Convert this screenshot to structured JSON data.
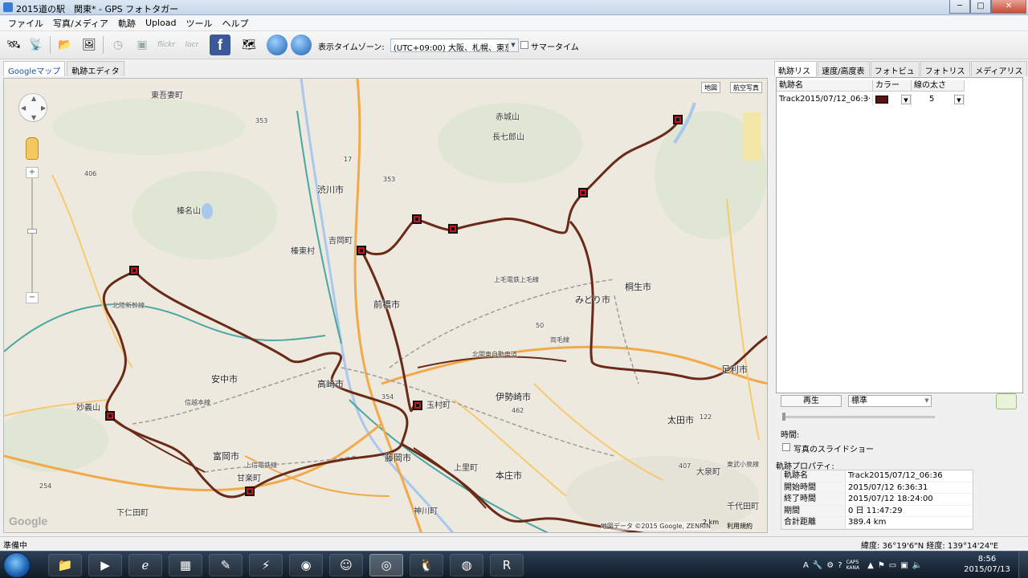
{
  "window": {
    "title": "2015道の駅　関東* - GPS フォトタガー",
    "minimize": "─",
    "maximize": "□",
    "close": "✕"
  },
  "menu": [
    "ファイル",
    "写真/メディア",
    "軌跡",
    "Upload",
    "ツール",
    "ヘルプ"
  ],
  "toolbar": {
    "timezone_label": "表示タイムゾーン:",
    "timezone_value": "(UTC+09:00) 大阪、札幌、東京",
    "summer_label": "サマータイム",
    "icons": [
      "gps-device-icon",
      "gps-receive-icon",
      "open-folder-icon",
      "photo-icon",
      "clock-icon",
      "camera-icon",
      "flickr-icon",
      "locr-icon",
      "facebook-icon",
      "picasa-icon",
      "google-earth-icon",
      "google-earth-kmz-icon"
    ],
    "flickr": "flickr",
    "locr": "locr",
    "facebook": "f"
  },
  "left_tabs": [
    "Googleマップ",
    "軌跡エディタ"
  ],
  "map": {
    "type_buttons": [
      "地図",
      "航空写真"
    ],
    "labels": {
      "higashiagatsuma": "東吾妻町",
      "shibukawa": "渋川市",
      "akagi": "赤城山",
      "choshichiro": "長七郎山",
      "haruna": "榛名山",
      "yoshioka": "吉岡町",
      "shinto": "榛東村",
      "maebashi": "前橋市",
      "midori": "みどり市",
      "kiryu": "桐生市",
      "jomo": "上毛電鉄上毛線",
      "hokuriku": "北陸新幹線",
      "annaka": "安中市",
      "takasaki": "高崎市",
      "tamamura": "玉村町",
      "isesaki": "伊勢崎市",
      "ashikaga": "足利市",
      "ota": "太田市",
      "myogi": "妙義山",
      "shinetsu": "信越本線",
      "tomioka": "富岡市",
      "joshin": "上信電鉄線",
      "kanra": "甘楽町",
      "fujioka": "藤岡市",
      "kamisato": "上里町",
      "honjo": "本庄市",
      "kamikawa": "神川町",
      "shimonita": "下仁田町",
      "oizumi": "大泉町",
      "chiyoda": "千代田町",
      "higashikoizumi": "東武小泉線",
      "ryomo": "両毛線",
      "kitakanto": "北関東自動車道",
      "route_353a": "353",
      "route_17": "17",
      "route_353b": "353",
      "route_406": "406",
      "route_354": "354",
      "route_462": "462",
      "route_50": "50",
      "route_122": "122",
      "route_254": "254",
      "route_407": "407"
    },
    "attribution": "地図データ ©2015 Google, ZENRIN",
    "scale": "2 km",
    "terms": "利用規約",
    "google": "Google"
  },
  "right_tabs": [
    "軌跡リスト",
    "速度/高度表示",
    "フォトビュー",
    "フォトリスト",
    "メディアリスト"
  ],
  "track_table": {
    "headers": [
      "軌跡名",
      "カラー",
      "線の太さ"
    ],
    "rows": [
      {
        "name": "Track2015/07/12_06:3",
        "more": "···",
        "width": "5",
        "color": "#5a1212"
      }
    ]
  },
  "playback": {
    "play": "再生",
    "speed": "標準",
    "time_label": "時間:",
    "slideshow_label": "写真のスライドショー"
  },
  "properties": {
    "title": "軌跡プロパティ:",
    "rows": [
      {
        "key": "軌跡名",
        "value": "Track2015/07/12_06:36"
      },
      {
        "key": "開始時間",
        "value": "2015/07/12 6:36:31"
      },
      {
        "key": "終了時間",
        "value": "2015/07/12 18:24:00"
      },
      {
        "key": "期間",
        "value": "0 日  11:47:29"
      },
      {
        "key": "合計距離",
        "value": "389.4 km"
      }
    ]
  },
  "status": {
    "left": "準備中",
    "right": "緯度: 36°19'6\"N  経度: 139°14'24\"E"
  },
  "taskbar": {
    "clock_time": "8:56",
    "clock_date": "2015/07/13",
    "caps": "CAPS",
    "kana": "KANA",
    "ime": "A"
  }
}
